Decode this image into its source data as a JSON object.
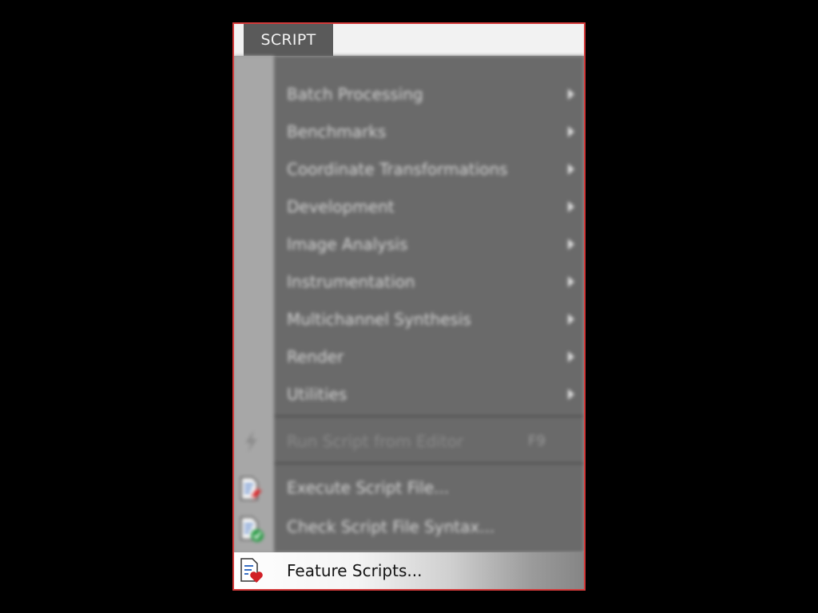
{
  "menu": {
    "title": "SCRIPT",
    "items": [
      {
        "label": "Batch Processing"
      },
      {
        "label": "Benchmarks"
      },
      {
        "label": "Coordinate Transformations"
      },
      {
        "label": "Development"
      },
      {
        "label": "Image Analysis"
      },
      {
        "label": "Instrumentation"
      },
      {
        "label": "Multichannel Synthesis"
      },
      {
        "label": "Render"
      },
      {
        "label": "Utilities"
      }
    ],
    "run_script": {
      "label": "Run Script from Editor",
      "shortcut": "F9",
      "icon": "lightning-bolt-icon"
    },
    "execute_script": {
      "label": "Execute Script File...",
      "icon": "script-file-execute-icon"
    },
    "check_script": {
      "label": "Check Script File Syntax...",
      "icon": "script-file-check-icon"
    },
    "feature_scripts": {
      "label": "Feature Scripts...",
      "icon": "script-file-heart-icon"
    }
  },
  "colors": {
    "frame_border": "#d33a3a",
    "menu_background": "#6a6a6a",
    "gutter": "#a7a7a7",
    "title_tab": "#5a5a5a"
  }
}
